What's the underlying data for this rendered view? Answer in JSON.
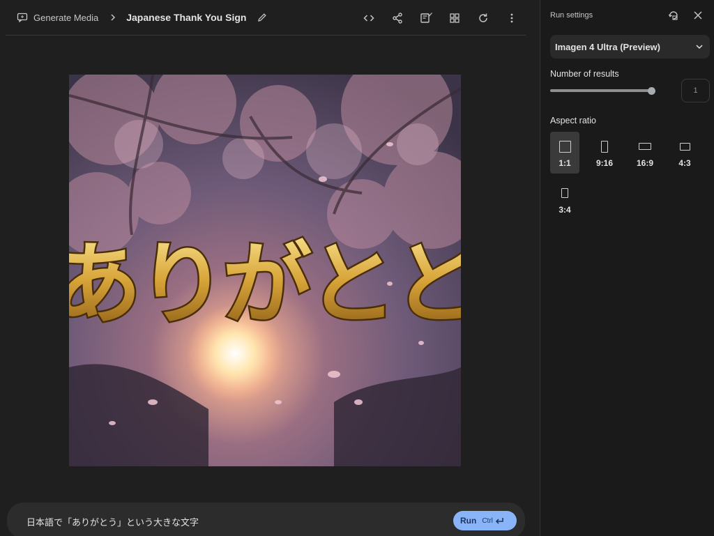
{
  "breadcrumb": {
    "root_label": "Generate Media",
    "title": "Japanese Thank You Sign"
  },
  "toolbar": {
    "icons": [
      "code-icon",
      "share-icon",
      "save-check-icon",
      "grid-icon",
      "refresh-icon",
      "more-vert-icon"
    ]
  },
  "image": {
    "caption_text": "ありがとと"
  },
  "prompt": {
    "text": "日本語で「ありがとう」という大きな文字",
    "run_label": "Run",
    "shortcut_label": "Ctrl"
  },
  "panel": {
    "title": "Run settings",
    "model": "Imagen 4 Ultra (Preview)",
    "results_label": "Number of results",
    "results_value": "1",
    "results_fraction": 1.0,
    "aspect_label": "Aspect ratio",
    "aspect_options": [
      {
        "label": "1:1",
        "selected": true
      },
      {
        "label": "9:16",
        "selected": false
      },
      {
        "label": "16:9",
        "selected": false
      },
      {
        "label": "4:3",
        "selected": false
      },
      {
        "label": "3:4",
        "selected": false
      }
    ]
  },
  "colors": {
    "background": "#1f1f1f",
    "panel": "#1a1a1a",
    "run_button": "#8ab4f8",
    "gold": "#d4a017"
  }
}
